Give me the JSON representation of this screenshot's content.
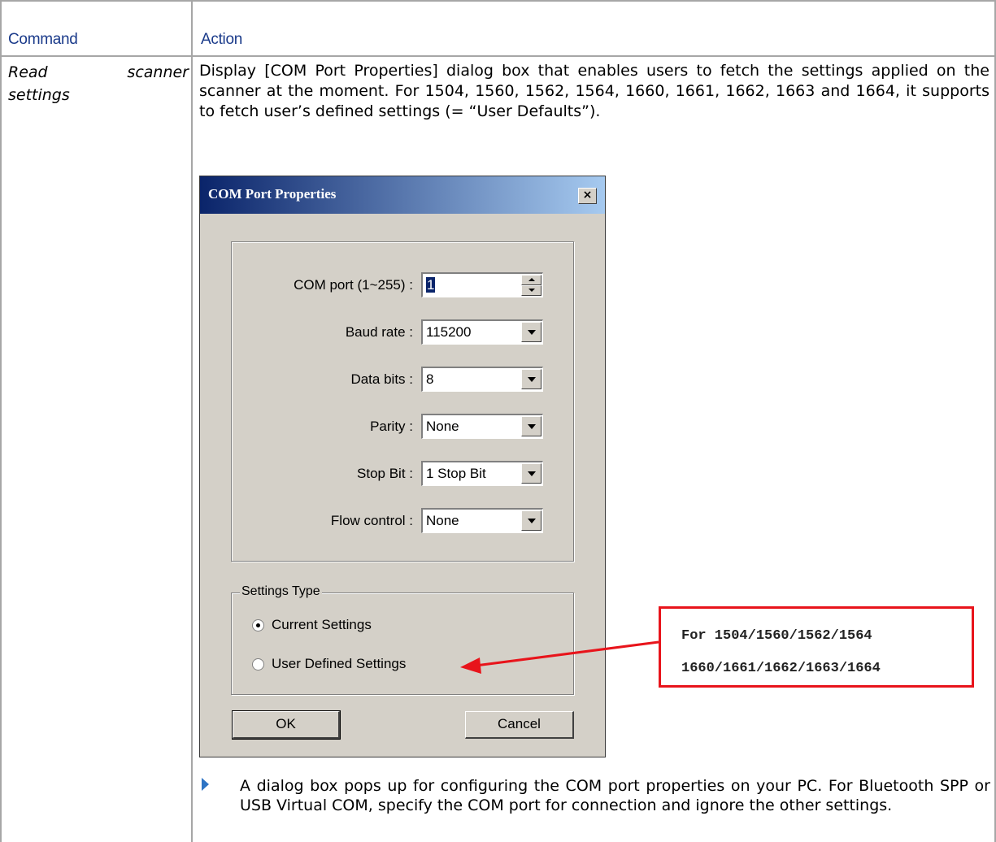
{
  "table": {
    "header_command": "Command",
    "header_action": "Action",
    "command_line1_word1": "Read",
    "command_line1_word2": "scanner",
    "command_line2": "settings",
    "action_text": "Display [COM Port Properties] dialog box that enables users to fetch the settings applied on the scanner at the moment. For 1504, 1560, 1562, 1564, 1660, 1661, 1662, 1663 and 1664, it supports to fetch user’s defined settings (= “User Defaults”).",
    "bullet_text": "A dialog box pops up for configuring the COM port properties on your PC. For Bluetooth SPP or USB Virtual COM, specify the COM port for connection and ignore the other settings."
  },
  "dialog": {
    "title": "COM Port Properties",
    "close_glyph": "×",
    "fields": [
      {
        "label": "COM port (1~255) :",
        "value": "1"
      },
      {
        "label": "Baud rate :",
        "value": "115200"
      },
      {
        "label": "Data bits :",
        "value": "8"
      },
      {
        "label": "Parity :",
        "value": "None"
      },
      {
        "label": "Stop Bit :",
        "value": "1 Stop Bit"
      },
      {
        "label": "Flow control :",
        "value": "None"
      }
    ],
    "settings_type": {
      "legend": "Settings Type",
      "options": [
        {
          "label": "Current Settings",
          "selected": true
        },
        {
          "label": "User Defined Settings",
          "selected": false
        }
      ]
    },
    "ok_label": "OK",
    "cancel_label": "Cancel"
  },
  "callout": {
    "line1": "For 1504/1560/1562/1564",
    "line2": "1660/1661/1662/1663/1664",
    "border_color": "#e8141b"
  },
  "icons": {
    "bullet": "triangle-bullet-icon",
    "dropdown": "chevron-down-icon",
    "spinner": "spinner-arrows-icon",
    "close": "close-icon",
    "arrow": "red-arrow-icon"
  },
  "colors": {
    "header_text": "#1a3a8a",
    "titlebar_start": "#0a246a",
    "titlebar_end": "#a6caf0",
    "dialog_face": "#d4d0c8",
    "bullet": "#2e74c4"
  }
}
